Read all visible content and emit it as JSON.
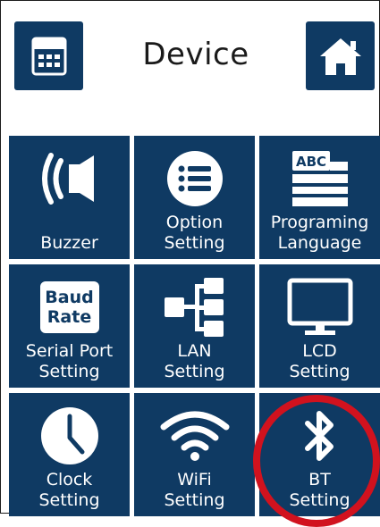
{
  "header": {
    "title": "Device",
    "left_icon": "calculator-icon",
    "right_icon": "home-icon"
  },
  "tiles": [
    {
      "label": "Buzzer",
      "icon": "speaker-icon"
    },
    {
      "label": "Option\nSetting",
      "icon": "list-icon"
    },
    {
      "label": "Programing\nLanguage",
      "icon": "printer-abc-icon",
      "icon_text": "ABC"
    },
    {
      "label": "Serial Port\nSetting",
      "icon": "baud-rate-icon",
      "icon_text_1": "Baud",
      "icon_text_2": "Rate"
    },
    {
      "label": "LAN\nSetting",
      "icon": "network-icon"
    },
    {
      "label": "LCD\nSetting",
      "icon": "monitor-icon"
    },
    {
      "label": "Clock\nSetting",
      "icon": "clock-icon"
    },
    {
      "label": "WiFi\nSetting",
      "icon": "wifi-icon"
    },
    {
      "label": "BT\nSetting",
      "icon": "bluetooth-icon"
    }
  ],
  "colors": {
    "tile": "#0f3a63",
    "highlight": "#d1121e",
    "text_on_tile": "#ffffff"
  }
}
